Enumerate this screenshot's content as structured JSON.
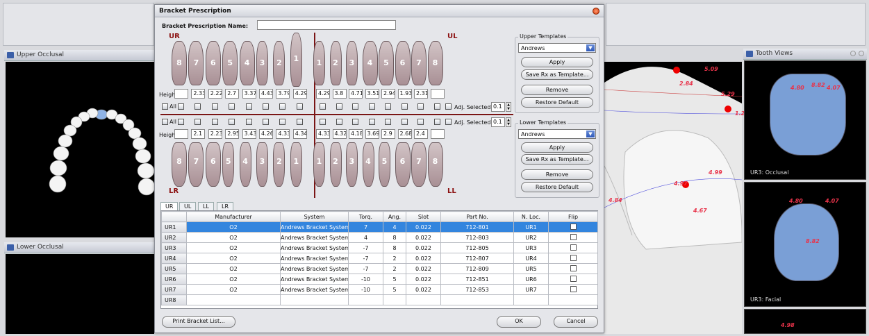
{
  "upper_occlusal": {
    "title": "Upper Occlusal"
  },
  "lower_occlusal": {
    "title": "Lower Occlusal"
  },
  "tooth_views": {
    "title": "Tooth Views",
    "occlusal_label": "UR3: Occlusal",
    "facial_label": "UR3: Facial",
    "measures_occlusal": [
      "4.80",
      "8.82",
      "4.07"
    ],
    "measures_facial": [
      "4.80",
      "4.07",
      "8.82"
    ],
    "measure_bottom": "4.98"
  },
  "main_view": {
    "measures": [
      "5.09",
      "2.84",
      "5.29",
      "1.2",
      "4.97",
      "4.99",
      "4.84",
      "4.67"
    ]
  },
  "dialog": {
    "title": "Bracket Prescription",
    "name_label": "Bracket Prescription Name:",
    "name_value": "",
    "ur": "UR",
    "ul": "UL",
    "lr": "LR",
    "ll": "LL",
    "height_label": "Height:",
    "all_label": "All",
    "adj_label": "Adj. Selected:",
    "adj_upper": "0.1",
    "adj_lower": "0.1",
    "upper_teeth": [
      "8",
      "7",
      "6",
      "5",
      "4",
      "3",
      "2",
      "1",
      "1",
      "2",
      "3",
      "4",
      "5",
      "6",
      "7",
      "8"
    ],
    "lower_teeth": [
      "8",
      "7",
      "6",
      "5",
      "4",
      "3",
      "2",
      "1",
      "1",
      "2",
      "3",
      "4",
      "5",
      "6",
      "7",
      "8"
    ],
    "upper_heights": [
      "",
      "2.33",
      "2.22",
      "2.7",
      "3.37",
      "4.43",
      "3.79",
      "4.29",
      "4.29",
      "3.8",
      "4.71",
      "3.51",
      "2.94",
      "1.93",
      "2.31",
      ""
    ],
    "lower_heights": [
      "",
      "2.1",
      "2.23",
      "2.95",
      "3.43",
      "4.26",
      "4.33",
      "4.34",
      "4.33",
      "4.32",
      "4.18",
      "3.69",
      "2.9",
      "2.68",
      "2.4",
      ""
    ],
    "upper_templates": {
      "title": "Upper Templates",
      "selected": "Andrews",
      "apply": "Apply",
      "save": "Save Rx as Template...",
      "remove": "Remove",
      "restore": "Restore Default"
    },
    "lower_templates": {
      "title": "Lower Templates",
      "selected": "Andrews",
      "apply": "Apply",
      "save": "Save Rx as Template...",
      "remove": "Remove",
      "restore": "Restore Default"
    },
    "tabs": [
      "UR",
      "UL",
      "LL",
      "LR"
    ],
    "columns": [
      "Manufacturer",
      "System",
      "Torq.",
      "Ang.",
      "Slot",
      "Part No.",
      "N. Loc.",
      "Flip"
    ],
    "rows": [
      {
        "id": "UR1",
        "m": "O2",
        "s": "Andrews Bracket System",
        "t": "7",
        "a": "4",
        "sl": "0.022",
        "p": "712-801",
        "n": "UR1"
      },
      {
        "id": "UR2",
        "m": "O2",
        "s": "Andrews Bracket System",
        "t": "4",
        "a": "8",
        "sl": "0.022",
        "p": "712-803",
        "n": "UR2"
      },
      {
        "id": "UR3",
        "m": "O2",
        "s": "Andrews Bracket System",
        "t": "-7",
        "a": "8",
        "sl": "0.022",
        "p": "712-805",
        "n": "UR3"
      },
      {
        "id": "UR4",
        "m": "O2",
        "s": "Andrews Bracket System",
        "t": "-7",
        "a": "2",
        "sl": "0.022",
        "p": "712-807",
        "n": "UR4"
      },
      {
        "id": "UR5",
        "m": "O2",
        "s": "Andrews Bracket System",
        "t": "-7",
        "a": "2",
        "sl": "0.022",
        "p": "712-809",
        "n": "UR5"
      },
      {
        "id": "UR6",
        "m": "O2",
        "s": "Andrews Bracket System",
        "t": "-10",
        "a": "5",
        "sl": "0.022",
        "p": "712-851",
        "n": "UR6"
      },
      {
        "id": "UR7",
        "m": "O2",
        "s": "Andrews Bracket System",
        "t": "-10",
        "a": "5",
        "sl": "0.022",
        "p": "712-853",
        "n": "UR7"
      },
      {
        "id": "UR8",
        "m": "",
        "s": "",
        "t": "",
        "a": "",
        "sl": "",
        "p": "",
        "n": ""
      }
    ],
    "print_button": "Print Bracket List...",
    "ok_button": "OK",
    "cancel_button": "Cancel"
  }
}
